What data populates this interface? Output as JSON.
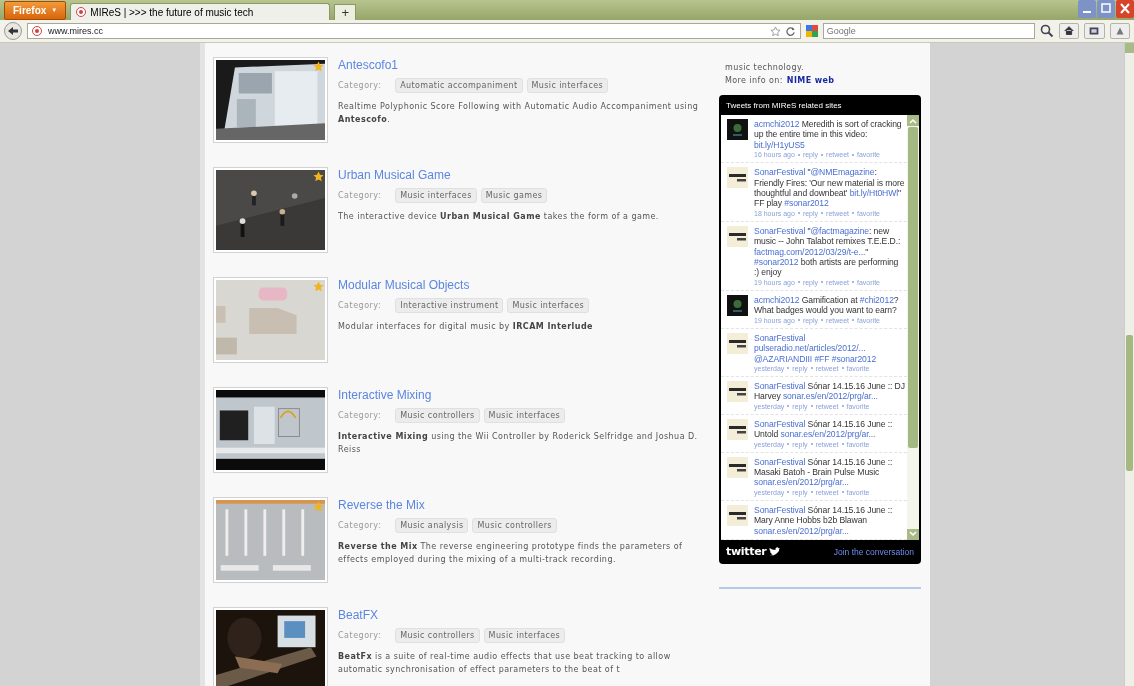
{
  "browser": {
    "menu_button": "Firefox",
    "menu_caret": "▼",
    "tabs": [
      {
        "title": "MIReS | >>> the future of music tech",
        "selected": true
      }
    ],
    "new_tab": "+",
    "url": "www.mires.cc",
    "search": {
      "placeholder": "Google"
    }
  },
  "items": [
    {
      "title": "Antescofo1",
      "category_label": "Category:",
      "categories": [
        "Automatic accompaniment",
        "Music interfaces"
      ],
      "description": "Realtime Polyphonic Score Following with Automatic Audio Accompaniment using **Antescofo**.",
      "starred": true
    },
    {
      "title": "Urban Musical Game",
      "category_label": "Category:",
      "categories": [
        "Music interfaces",
        "Music games"
      ],
      "description": "The interactive device **Urban Musical Game** takes the form of a game.",
      "starred": true
    },
    {
      "title": "Modular Musical Objects",
      "category_label": "Category:",
      "categories": [
        "Interactive instrument",
        "Music interfaces"
      ],
      "description": "Modular interfaces for digital music by **IRCAM Interlude**",
      "starred": true
    },
    {
      "title": "Interactive Mixing",
      "category_label": "Category:",
      "categories": [
        "Music controllers",
        "Music interfaces"
      ],
      "description": "**Interactive Mixing** using the Wii Controller by Roderick Selfridge and Joshua D. Reiss",
      "starred": false
    },
    {
      "title": "Reverse the Mix",
      "category_label": "Category:",
      "categories": [
        "Music analysis",
        "Music controllers"
      ],
      "description": "**Reverse the Mix**  The reverse engineering prototype finds the parameters of effects employed during the mixing of a multi-track recording.",
      "starred": true
    },
    {
      "title": "BeatFX",
      "category_label": "Category:",
      "categories": [
        "Music controllers",
        "Music interfaces"
      ],
      "description": "**BeatFx** is a suite of real-time audio effects that use beat tracking to allow automatic synchronisation of effect parameters to the beat of t",
      "starred": false
    }
  ],
  "sidebar": {
    "text": "music technology.",
    "more_info": {
      "label": "More info on:",
      "link": "NIME web"
    },
    "tweets_widget": {
      "title": "Tweets from MIReS related sites",
      "tweets": [
        {
          "kind": "acm",
          "user": "acmchi2012",
          "parts": [
            {
              "kind": "text",
              "t": "Meredith is sort of cracking up the entire time in this video: "
            },
            {
              "kind": "link",
              "t": "bit.ly/H1yUS5"
            }
          ],
          "time": "16 hours ago",
          "actions": [
            "reply",
            "retweet",
            "favorite"
          ]
        },
        {
          "kind": "sonar",
          "user": "SonarFestival",
          "parts": [
            {
              "kind": "text",
              "t": "\""
            },
            {
              "kind": "link",
              "t": "@NMEmagazine"
            },
            {
              "kind": "text",
              "t": ": Friendly Fires: 'Our new material is more thoughtful and downbeat' "
            },
            {
              "kind": "link",
              "t": "bit.ly/Ht0HWl"
            },
            {
              "kind": "text",
              "t": "\" FF play "
            },
            {
              "kind": "link",
              "t": "#sonar2012"
            }
          ],
          "time": "18 hours ago",
          "actions": [
            "reply",
            "retweet",
            "favorite"
          ]
        },
        {
          "kind": "sonar",
          "user": "SonarFestival",
          "parts": [
            {
              "kind": "text",
              "t": "\""
            },
            {
              "kind": "link",
              "t": "@factmagazine"
            },
            {
              "kind": "text",
              "t": ": new music -- John Talabot remixes T.E.E.D.: "
            },
            {
              "kind": "link",
              "t": "factmag.com/2012/03/29/t-e..."
            },
            {
              "kind": "text",
              "t": "\" "
            },
            {
              "kind": "link",
              "t": "#sonar2012"
            },
            {
              "kind": "text",
              "t": " both artists are performing :) enjoy"
            }
          ],
          "time": "19 hours ago",
          "actions": [
            "reply",
            "retweet",
            "favorite"
          ]
        },
        {
          "kind": "acm",
          "user": "acmchi2012",
          "parts": [
            {
              "kind": "text",
              "t": "Gamification at "
            },
            {
              "kind": "link",
              "t": "#chi2012"
            },
            {
              "kind": "text",
              "t": "? What badges would you want to earn?"
            }
          ],
          "time": "19 hours ago",
          "actions": [
            "reply",
            "retweet",
            "favorite"
          ]
        },
        {
          "kind": "sonar",
          "user": "SonarFestival",
          "parts": [
            {
              "kind": "link",
              "t": "pulseradio.net/articles/2012/..."
            },
            {
              "kind": "link",
              "t": "@AZARIANDIII"
            },
            {
              "kind": "link",
              "t": "#FF"
            },
            {
              "kind": "link",
              "t": "#sonar2012"
            }
          ],
          "time": "yesterday",
          "actions": [
            "reply",
            "retweet",
            "favorite"
          ]
        },
        {
          "kind": "sonar",
          "user": "SonarFestival",
          "parts": [
            {
              "kind": "text",
              "t": "Sónar 14.15.16 June :: DJ Harvey "
            },
            {
              "kind": "link",
              "t": "sonar.es/en/2012/prg/ar..."
            }
          ],
          "time": "yesterday",
          "actions": [
            "reply",
            "retweet",
            "favorite"
          ]
        },
        {
          "kind": "sonar",
          "user": "SonarFestival",
          "parts": [
            {
              "kind": "text",
              "t": "Sónar 14.15.16 June :: Untold "
            },
            {
              "kind": "link",
              "t": "sonar.es/en/2012/prg/ar..."
            }
          ],
          "time": "yesterday",
          "actions": [
            "reply",
            "retweet",
            "favorite"
          ]
        },
        {
          "kind": "sonar",
          "user": "SonarFestival",
          "parts": [
            {
              "kind": "text",
              "t": "Sónar 14.15.16 June :: Masaki Batoh - Brain Pulse Music "
            },
            {
              "kind": "link",
              "t": "sonar.es/en/2012/prg/ar..."
            }
          ],
          "time": "yesterday",
          "actions": [
            "reply",
            "retweet",
            "favorite"
          ]
        },
        {
          "kind": "sonar",
          "user": "SonarFestival",
          "parts": [
            {
              "kind": "text",
              "t": "Sónar 14.15.16 June :: Mary Anne Hobbs b2b Blawan "
            },
            {
              "kind": "link",
              "t": "sonar.es/en/2012/prg/ar..."
            }
          ]
        }
      ],
      "logo": "twitter",
      "footer_link": "Join the conversation"
    }
  }
}
